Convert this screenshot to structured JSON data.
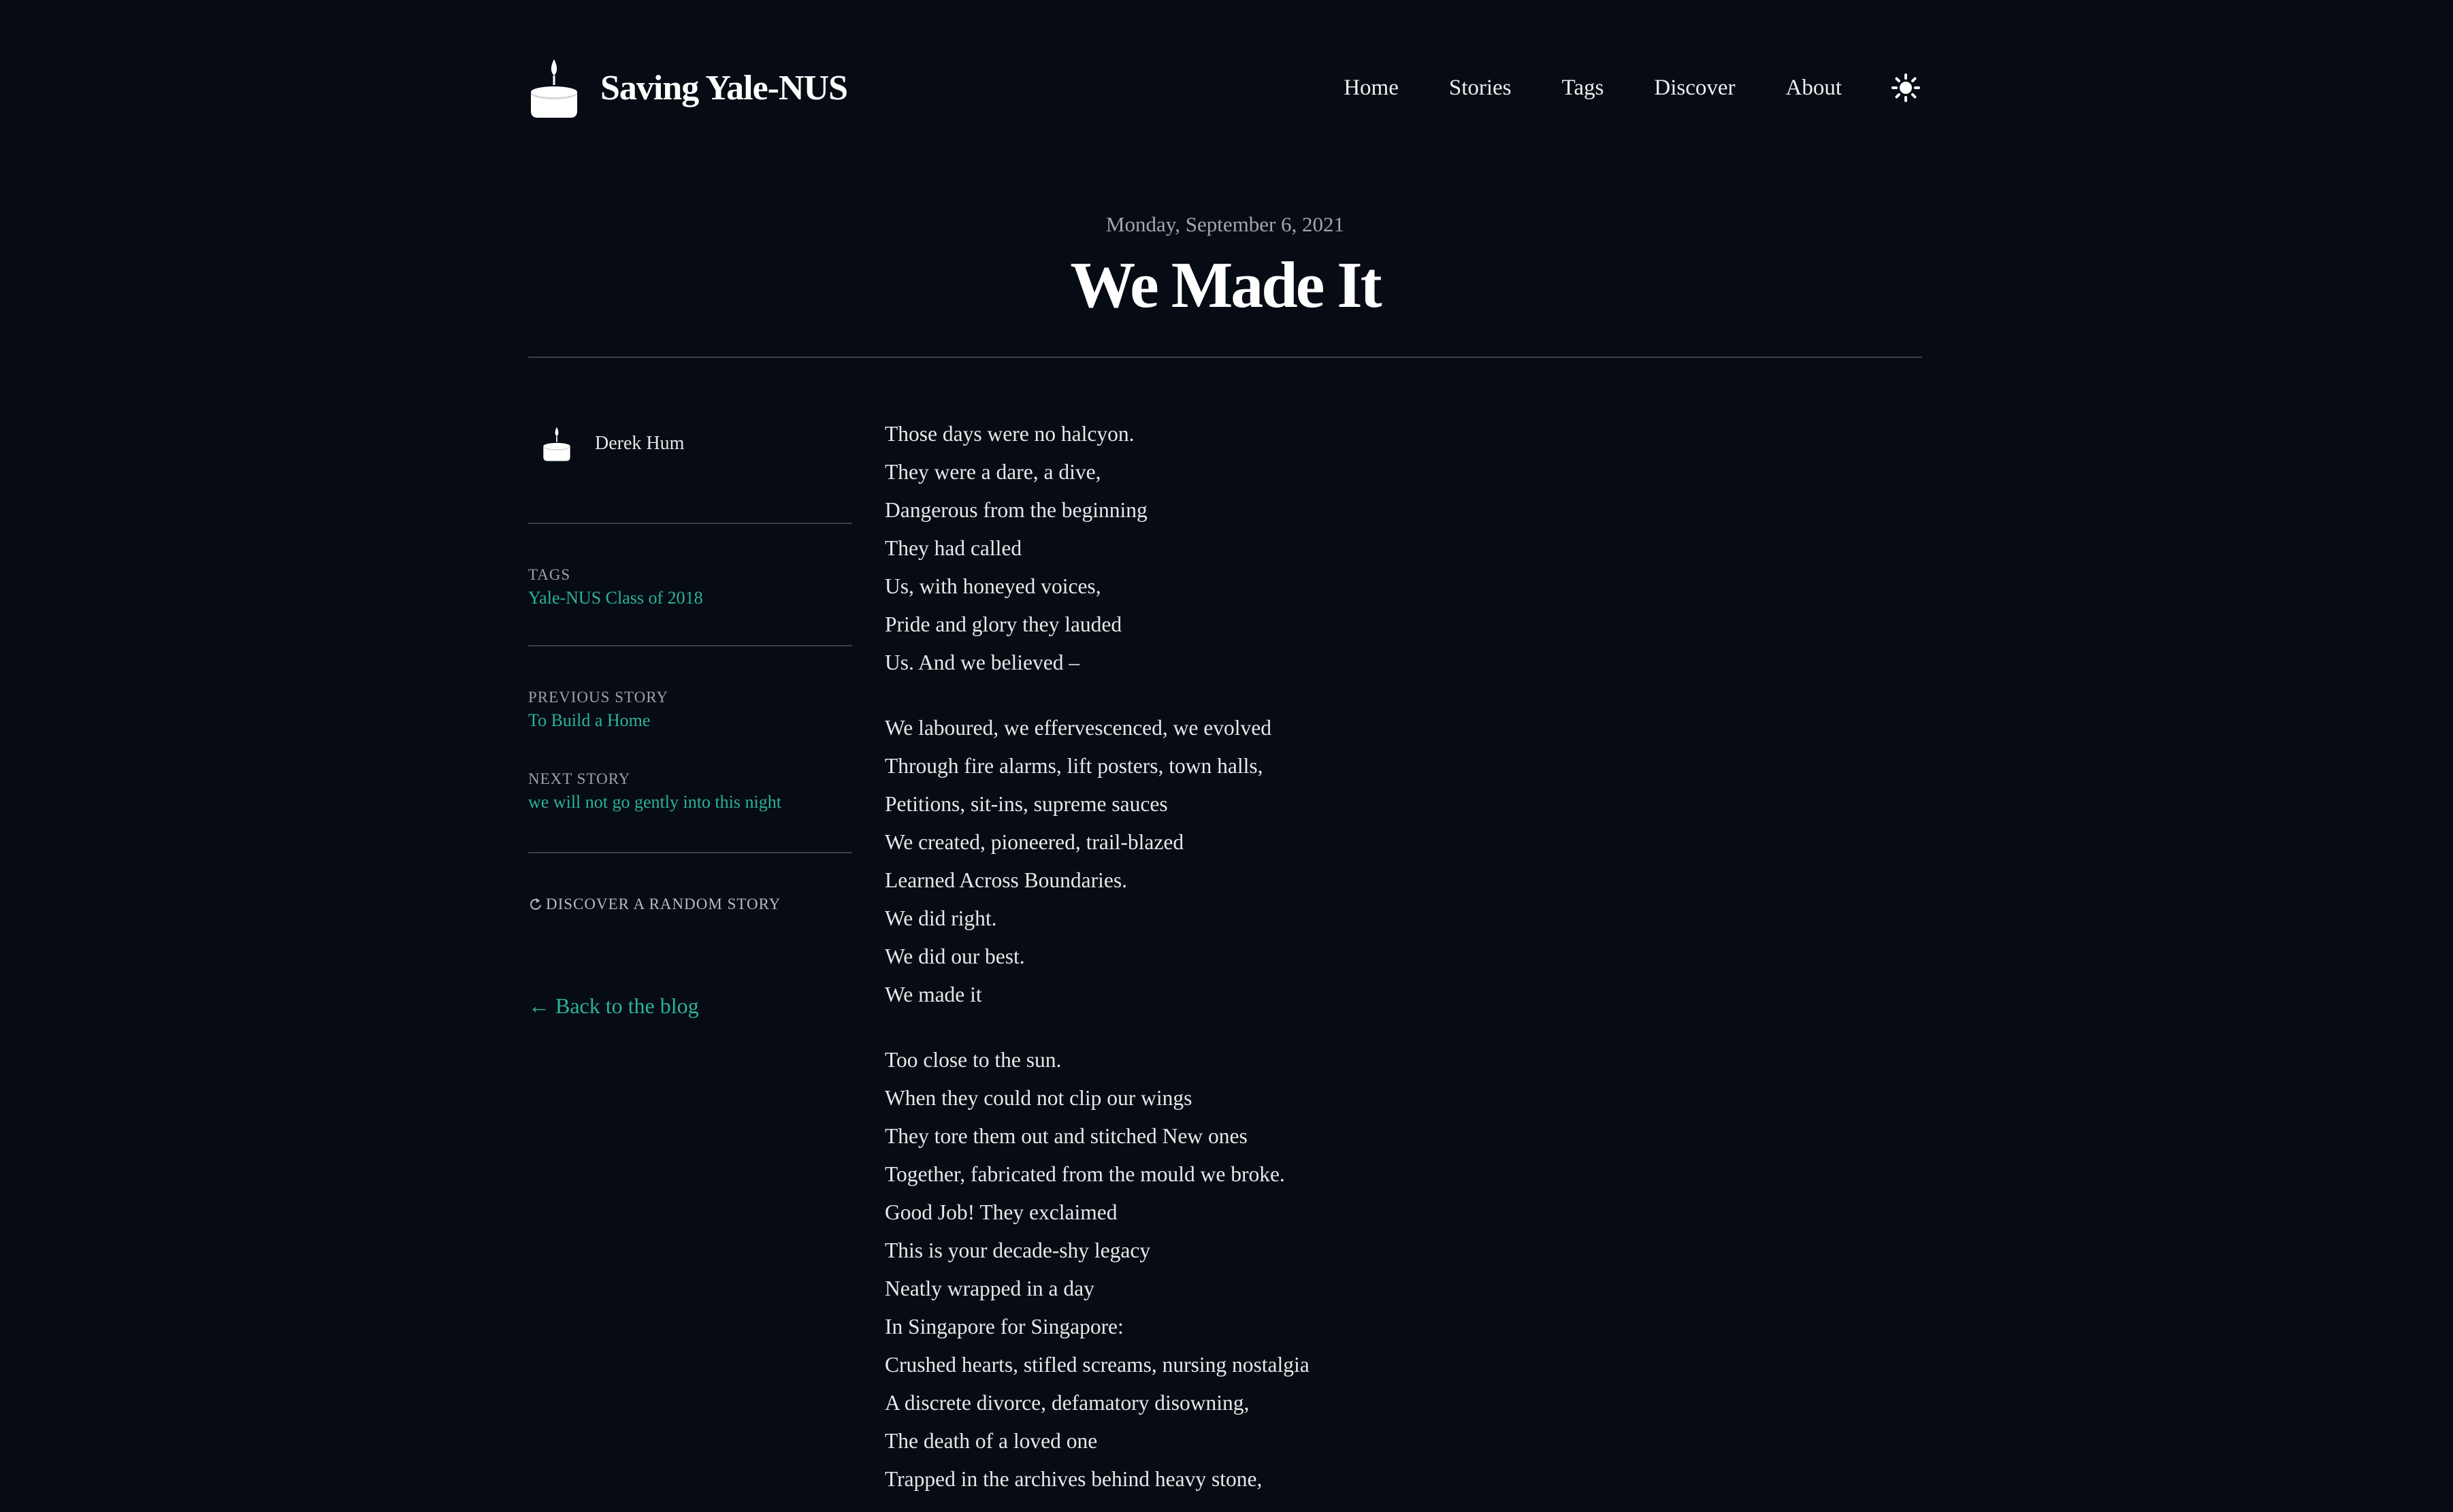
{
  "site": {
    "name": "Saving Yale-NUS",
    "logo_icon": "candle-icon",
    "nav": [
      {
        "label": "Home"
      },
      {
        "label": "Stories"
      },
      {
        "label": "Tags"
      },
      {
        "label": "Discover"
      },
      {
        "label": "About"
      }
    ],
    "theme_toggle_icon": "sun-icon"
  },
  "post": {
    "date": "Monday, September 6, 2021",
    "title": "We Made It"
  },
  "sidebar": {
    "author": "Derek Hum",
    "tags_label": "TAGS",
    "tags": [
      "Yale-NUS Class of 2018"
    ],
    "previous_label": "PREVIOUS STORY",
    "previous_title": "To Build a Home",
    "next_label": "NEXT STORY",
    "next_title": "we will not go gently into this night",
    "random_label": "DISCOVER A RANDOM STORY",
    "back_label": "← Back to the blog"
  },
  "poem": {
    "stanzas": [
      [
        "Those days were no halcyon.",
        "They were a dare, a dive,",
        "Dangerous from the beginning",
        "They had called",
        "Us, with honeyed voices,",
        "Pride and glory they lauded",
        "Us. And we believed –"
      ],
      [
        "We laboured, we effervescenced, we evolved",
        "Through fire alarms, lift posters, town halls,",
        "Petitions, sit-ins, supreme sauces",
        "We created, pioneered, trail-blazed",
        "Learned Across Boundaries.",
        "We did right.",
        "We did our best.",
        "We made it"
      ],
      [
        "Too close to the sun.",
        "When they could not clip our wings",
        "They tore them out and stitched New ones",
        "Together, fabricated from the mould we broke.",
        "Good Job! They exclaimed",
        "This is your decade-shy legacy",
        "Neatly wrapped in a day",
        "In Singapore for Singapore:",
        "Crushed hearts, stifled screams, nursing nostalgia",
        "A discrete divorce, defamatory disowning,",
        "The death of a loved one",
        "Trapped in the archives behind heavy stone,"
      ]
    ]
  },
  "colors": {
    "background": "#070b13",
    "accent": "#2ab39b",
    "text": "#e8e8e8",
    "muted": "#a3a6ac"
  }
}
